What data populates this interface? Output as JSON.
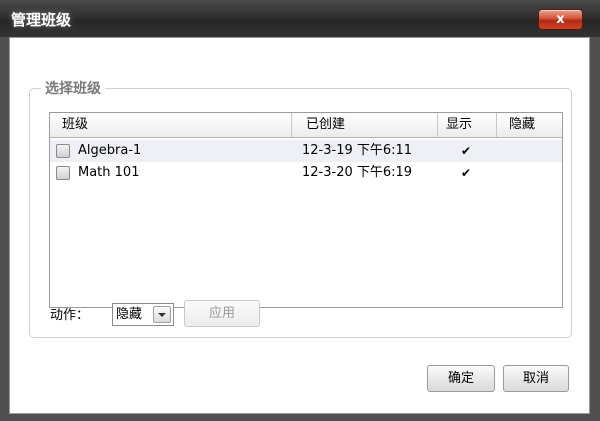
{
  "dialog": {
    "title": "管理班级",
    "close_label": "x"
  },
  "group": {
    "label": "选择班级"
  },
  "table": {
    "columns": [
      "班级",
      "已创建",
      "显示",
      "隐藏"
    ],
    "rows": [
      {
        "name": "Algebra-1",
        "created": "12-3-19 下午6:11",
        "show": "✔",
        "hide": ""
      },
      {
        "name": "Math 101",
        "created": "12-3-20 下午6:19",
        "show": "✔",
        "hide": ""
      }
    ]
  },
  "actions": {
    "label": "动作：",
    "selected": "隐藏",
    "apply_label": "应用"
  },
  "footer": {
    "ok_label": "确定",
    "cancel_label": "取消"
  }
}
